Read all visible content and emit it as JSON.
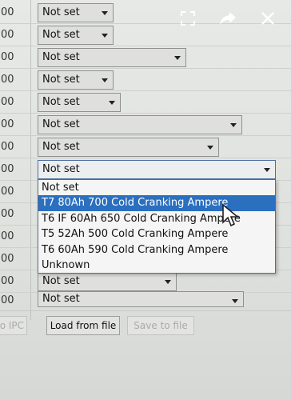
{
  "rows": [
    {
      "num": "00",
      "value": "Not set"
    },
    {
      "num": "00",
      "value": "Not set"
    },
    {
      "num": "00",
      "value": "Not set"
    },
    {
      "num": "00",
      "value": "Not set"
    },
    {
      "num": "00",
      "value": "Not set"
    },
    {
      "num": "00",
      "value": "Not set"
    },
    {
      "num": "00",
      "value": "Not set"
    },
    {
      "num": "00",
      "value": "Not set"
    },
    {
      "num": "00",
      "value": "Not set"
    },
    {
      "num": "00",
      "value": "Not set"
    }
  ],
  "hidden_row_nums": [
    "00",
    "00",
    "00",
    "00"
  ],
  "dropdown": {
    "options": [
      "Not set",
      "T7 80Ah 700 Cold Cranking Ampere",
      "T6 IF 60Ah 650 Cold Cranking Ampere",
      "T5 52Ah 500 Cold Cranking Ampere",
      "T6 60Ah 590 Cold Cranking Ampere",
      "Unknown"
    ],
    "selected_index": 1
  },
  "buttons": {
    "to_ipc": "o IPC",
    "load_from_file": "Load from file",
    "save_to_file": "Save to file"
  },
  "overlay_icons": [
    "fullscreen-icon",
    "share-icon",
    "close-icon"
  ]
}
